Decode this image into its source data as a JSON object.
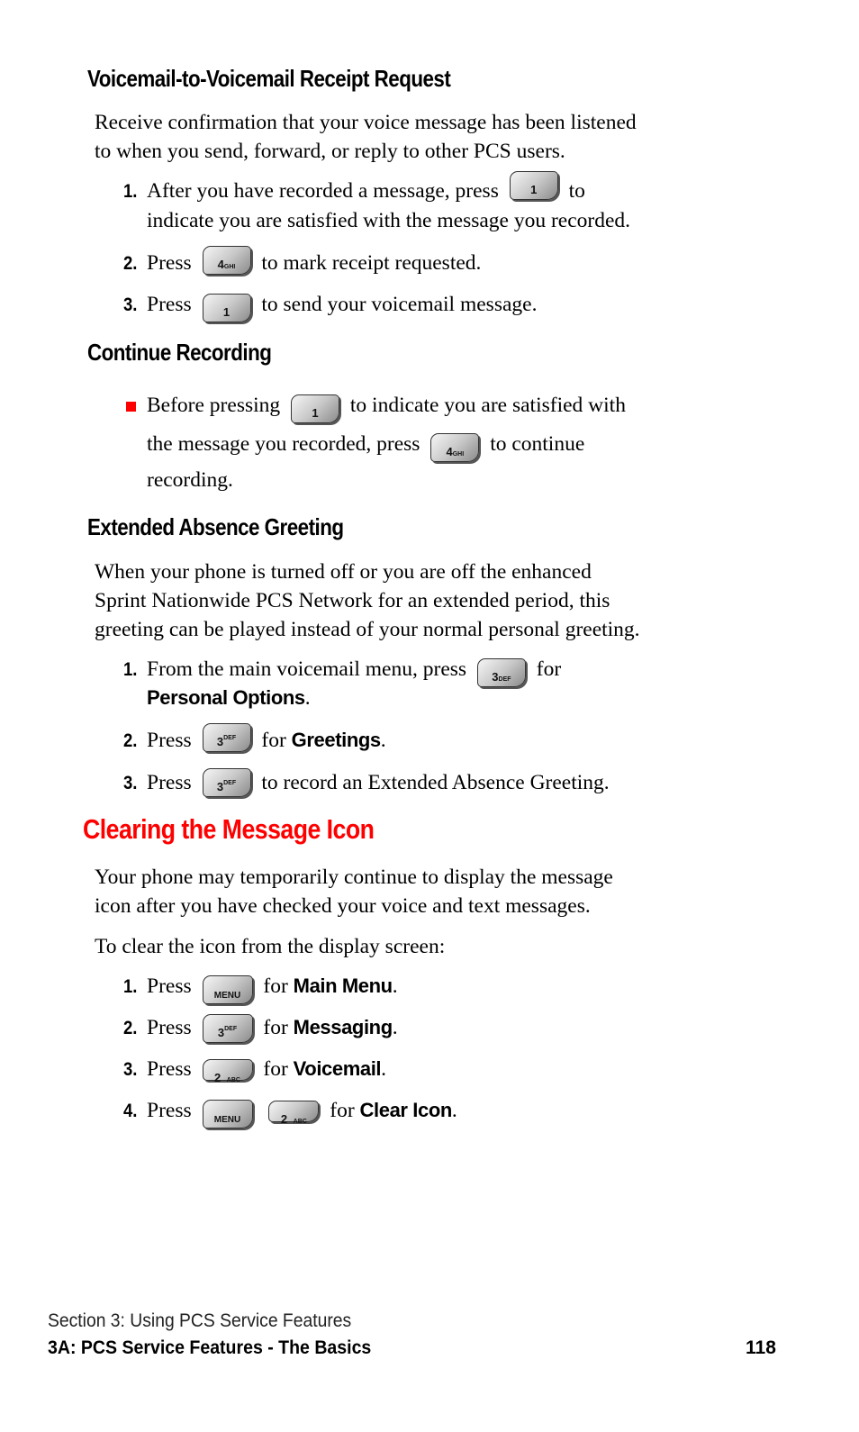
{
  "sections": {
    "receipt": {
      "heading": "Voicemail-to-Voicemail Receipt Request",
      "intro_line1": "Receive confirmation that your voice message has been listened",
      "intro_line2": "to when you send, forward, or reply to other PCS users.",
      "steps": [
        {
          "num": "1.",
          "pre": "After you have recorded a message, press",
          "post": "to",
          "line2": "indicate you are satisfied with the message you recorded.",
          "key": {
            "main": "1",
            "sub": ""
          }
        },
        {
          "num": "2.",
          "pre": "Press",
          "post": "to mark receipt requested.",
          "key": {
            "main": "4",
            "sub": "GHI"
          }
        },
        {
          "num": "3.",
          "pre": "Press",
          "post": "to send your voicemail message.",
          "key": {
            "main": "1",
            "sub": ""
          }
        }
      ]
    },
    "continue": {
      "heading": "Continue Recording",
      "bullet_pre": "Before pressing",
      "bullet_post": "to indicate you are satisfied with",
      "line2_pre": "the message you recorded, press",
      "line2_post": "to continue",
      "line3": "recording.",
      "key1": {
        "main": "1",
        "sub": ""
      },
      "key2": {
        "main": "4",
        "sub": "GHI"
      }
    },
    "absence": {
      "heading": "Extended Absence Greeting",
      "intro_line1": "When your phone is turned off or you are off the enhanced",
      "intro_line2": "Sprint Nationwide PCS Network for an extended period, this",
      "intro_line3": "greeting can be played instead of your normal personal greeting.",
      "steps": [
        {
          "num": "1.",
          "pre": "From the main voicemail menu, press",
          "post": "for",
          "line2_bold": "Personal Options",
          "line2_end": ".",
          "key": {
            "main": "3",
            "sub": "DEF"
          }
        },
        {
          "num": "2.",
          "pre": "Press",
          "post": "for",
          "bold": "Greetings",
          "end": ".",
          "key": {
            "main": "3",
            "sub": "DEF"
          }
        },
        {
          "num": "3.",
          "pre": "Press",
          "post": "to record an Extended Absence Greeting.",
          "key": {
            "main": "3",
            "sub": "DEF"
          }
        }
      ]
    },
    "clearing": {
      "heading": "Clearing the Message Icon",
      "intro_line1": "Your phone may temporarily continue to display the message",
      "intro_line2": "icon after you have checked your voice and text messages.",
      "lead": "To clear the icon from the display screen:",
      "steps": [
        {
          "num": "1.",
          "pre": "Press",
          "post": "for",
          "bold": "Main Menu",
          "end": ".",
          "keys": [
            {
              "main": "MENU",
              "sub": ""
            }
          ]
        },
        {
          "num": "2.",
          "pre": "Press",
          "post": "for",
          "bold": "Messaging",
          "end": ".",
          "keys": [
            {
              "main": "3",
              "sub": "DEF"
            }
          ]
        },
        {
          "num": "3.",
          "pre": "Press",
          "post": "for",
          "bold": "Voicemail",
          "end": ".",
          "keys": [
            {
              "main": "2",
              "sub": "ABC"
            }
          ]
        },
        {
          "num": "4.",
          "pre": "Press",
          "post": "for",
          "bold": "Clear Icon",
          "end": ".",
          "keys": [
            {
              "main": "MENU",
              "sub": ""
            },
            {
              "main": "2",
              "sub": "ABC"
            }
          ]
        }
      ]
    }
  },
  "footer": {
    "section": "Section 3: Using PCS Service Features",
    "chapter": "3A: PCS Service Features - The Basics",
    "page": "118"
  },
  "colors": {
    "accent": "#ff0000",
    "text": "#000000"
  }
}
